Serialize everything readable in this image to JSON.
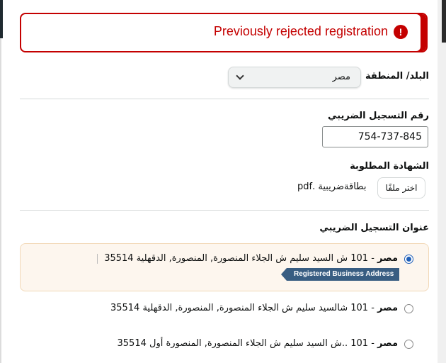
{
  "alert": {
    "message": "Previously rejected registration",
    "icon": "!"
  },
  "country": {
    "label": "البلد/ المنطقة",
    "selected": "مصر"
  },
  "tax_number": {
    "label": "رقم التسجيل الضريبي",
    "value": "754-737-845"
  },
  "certificate": {
    "label": "الشهادة المطلوبة",
    "button": "اختر ملفًا",
    "file_name": "بطاقةضريبية .pdf"
  },
  "tax_address": {
    "label": "عنوان التسجيل الضريبي",
    "options": [
      {
        "country": "مصر",
        "address": "- 101 ش السيد سليم ش الجلاء المنصورة, المنصورة, الدقهلية 35514",
        "badge": "Registered Business Address",
        "selected": true
      },
      {
        "country": "مصر",
        "address": "- 101 شالسيد سليم ش الجلاء المنصورة, المنصورة, الدقهلية 35514",
        "selected": false
      },
      {
        "country": "مصر",
        "address": "- 101 ..ش السيد سليم ش الجلاء المنصورة, المنصورة أول 35514",
        "selected": false
      }
    ]
  }
}
